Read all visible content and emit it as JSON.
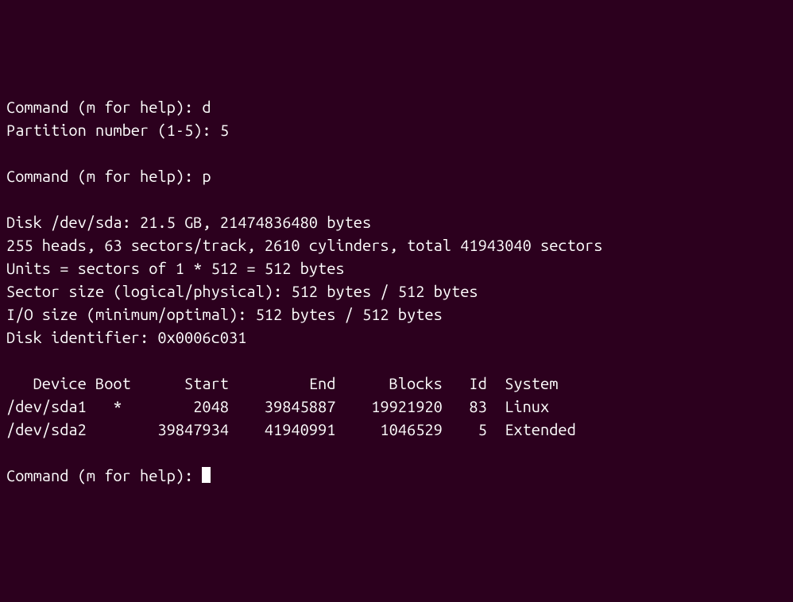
{
  "prompts": {
    "cmd1_label": "Command (m for help): ",
    "cmd1_input": "d",
    "partnum_label": "Partition number (1-5): ",
    "partnum_input": "5",
    "cmd2_label": "Command (m for help): ",
    "cmd2_input": "p",
    "cmd3_label": "Command (m for help): "
  },
  "disk_info": {
    "line1": "Disk /dev/sda: 21.5 GB, 21474836480 bytes",
    "line2": "255 heads, 63 sectors/track, 2610 cylinders, total 41943040 sectors",
    "line3": "Units = sectors of 1 * 512 = 512 bytes",
    "line4": "Sector size (logical/physical): 512 bytes / 512 bytes",
    "line5": "I/O size (minimum/optimal): 512 bytes / 512 bytes",
    "line6": "Disk identifier: 0x0006c031"
  },
  "table": {
    "header": "   Device Boot      Start         End      Blocks   Id  System",
    "row1": "/dev/sda1   *        2048    39845887    19921920   83  Linux",
    "row2": "/dev/sda2        39847934    41940991     1046529    5  Extended"
  }
}
